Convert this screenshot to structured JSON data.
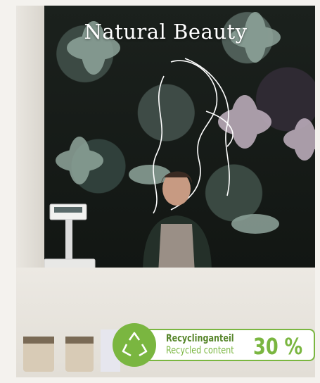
{
  "title": "Natural Beauty",
  "badge": {
    "line1": "Recyclinganteil",
    "line2": "Recycled content",
    "percent": "30 %",
    "icon": "recycle-icon",
    "color": "#7ab640"
  }
}
